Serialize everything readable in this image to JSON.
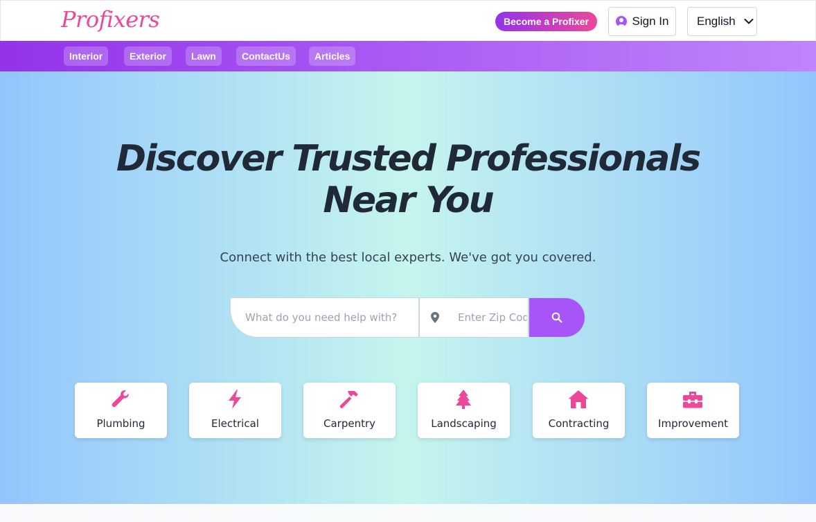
{
  "header": {
    "logo": "Profixers",
    "become_label": "Become a Profixer",
    "signin_label": "Sign In",
    "language": "English"
  },
  "nav": {
    "items": [
      {
        "label": "Interior"
      },
      {
        "label": "Exterior"
      },
      {
        "label": "Lawn"
      },
      {
        "label": "ContactUs"
      },
      {
        "label": "Articles"
      }
    ]
  },
  "hero": {
    "title_line1": "Discover Trusted Professionals",
    "title_line2": "Near You",
    "subtitle": "Connect with the best local experts. We've got you covered."
  },
  "search": {
    "service_placeholder": "What do you need help with?",
    "zip_placeholder": "Enter Zip Code"
  },
  "categories": [
    {
      "label": "Plumbing",
      "icon": "wrench-icon"
    },
    {
      "label": "Electrical",
      "icon": "bolt-icon"
    },
    {
      "label": "Carpentry",
      "icon": "hammer-icon"
    },
    {
      "label": "Landscaping",
      "icon": "tree-icon"
    },
    {
      "label": "Contracting",
      "icon": "house-icon"
    },
    {
      "label": "Improvement",
      "icon": "toolbox-icon"
    }
  ],
  "colors": {
    "accent": "#ec4899",
    "purple": "#a855f7",
    "nav_start": "#9333ea"
  }
}
